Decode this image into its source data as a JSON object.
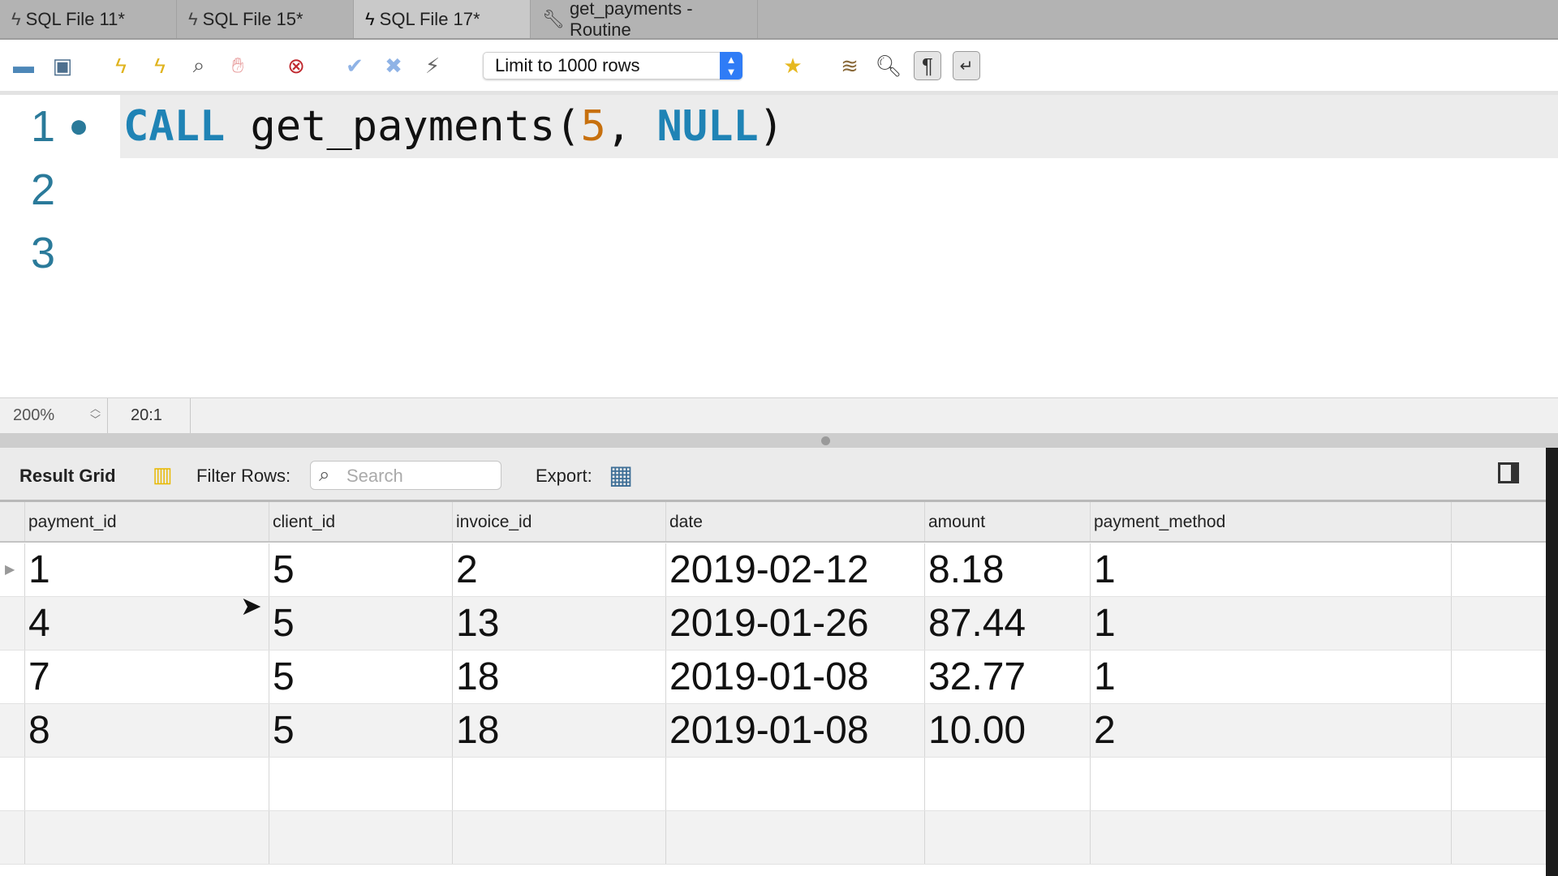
{
  "tabs": [
    {
      "label": "SQL File 11*",
      "icon": "lightning-icon"
    },
    {
      "label": "SQL File 15*",
      "icon": "lightning-icon"
    },
    {
      "label": "SQL File 17*",
      "icon": "lightning-icon",
      "active": true
    },
    {
      "label": "get_payments - Routine",
      "icon": "wrench-icon"
    }
  ],
  "toolbar": {
    "limit_select": "Limit to 1000 rows"
  },
  "editor": {
    "lines": [
      "1",
      "2",
      "3"
    ],
    "code": {
      "kw": "CALL",
      "fn": " get_payments(",
      "arg1": "5",
      ", ": ", ",
      "arg2": "NULL",
      "close": ")"
    }
  },
  "status": {
    "zoom": "200%",
    "position": "20:1"
  },
  "result": {
    "title": "Result Grid",
    "filter_label": "Filter Rows:",
    "search_placeholder": "Search",
    "export_label": "Export:",
    "columns": [
      "payment_id",
      "client_id",
      "invoice_id",
      "date",
      "amount",
      "payment_method"
    ],
    "rows": [
      [
        "1",
        "5",
        "2",
        "2019-02-12",
        "8.18",
        "1"
      ],
      [
        "4",
        "5",
        "13",
        "2019-01-26",
        "87.44",
        "1"
      ],
      [
        "7",
        "5",
        "18",
        "2019-01-08",
        "32.77",
        "1"
      ],
      [
        "8",
        "5",
        "18",
        "2019-01-08",
        "10.00",
        "2"
      ]
    ]
  }
}
